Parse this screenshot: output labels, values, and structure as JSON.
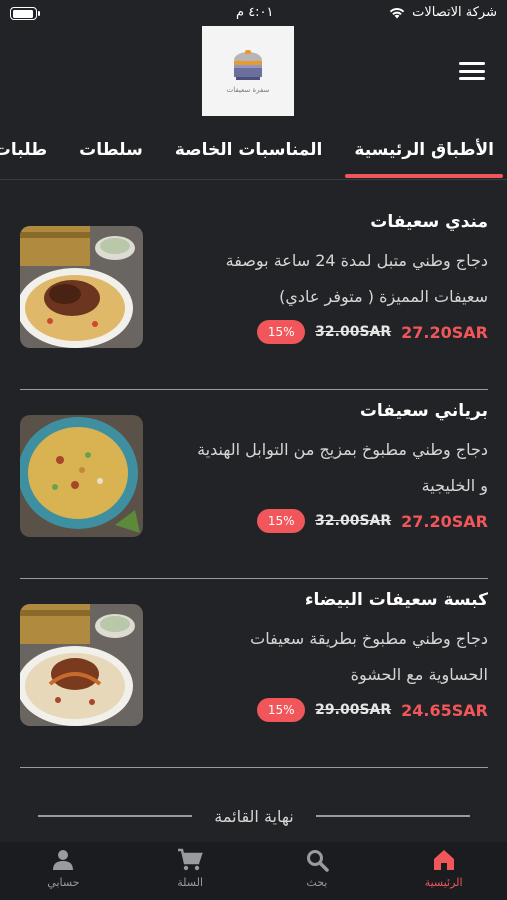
{
  "status": {
    "carrier": "شركة الاتصالات",
    "time": "٤:٠١ م"
  },
  "header": {
    "logo_caption": "سفرة سعيفات",
    "menu_icon": "hamburger-icon"
  },
  "tabs": [
    {
      "label": "الأطباق الرئيسية",
      "active": true
    },
    {
      "label": "المناسبات الخاصة",
      "active": false
    },
    {
      "label": "سلطات",
      "active": false
    },
    {
      "label": "طلبات جانبية",
      "active": false
    }
  ],
  "items": [
    {
      "name": "مندي سعيفات",
      "description": "دجاج وطني متبل لمدة 24 ساعة بوصفة سعيفات المميزة ( متوفر عادي)",
      "price": "27.20SAR",
      "old_price": "32.00SAR",
      "discount": "15%"
    },
    {
      "name": "برياني سعيفات",
      "description": "دجاج وطني مطبوخ بمزيج من التوابل الهندية و الخليجية",
      "price": "27.20SAR",
      "old_price": "32.00SAR",
      "discount": "15%"
    },
    {
      "name": "كبسة سعيفات البيضاء",
      "description": "دجاج وطني مطبوخ بطريقة سعيفات الحساوية مع الحشوة",
      "price": "24.65SAR",
      "old_price": "29.00SAR",
      "discount": "15%"
    }
  ],
  "end_of_list": "نهاية القائمة",
  "nav": [
    {
      "label": "الرئيسية",
      "icon": "home-icon",
      "active": true
    },
    {
      "label": "بحث",
      "icon": "search-icon",
      "active": false
    },
    {
      "label": "السلة",
      "icon": "cart-icon",
      "active": false
    },
    {
      "label": "حسابي",
      "icon": "account-icon",
      "active": false
    }
  ],
  "colors": {
    "accent": "#f0565a",
    "background": "#222326",
    "nav_background": "#1b1c1f"
  }
}
